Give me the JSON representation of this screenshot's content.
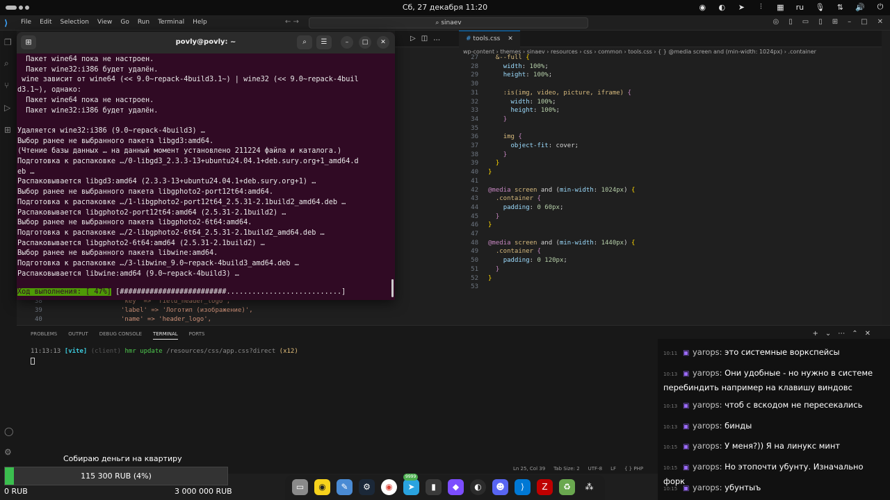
{
  "topbar": {
    "clock": "Сб, 27 декабря 11:20",
    "lang": "ru"
  },
  "vscode": {
    "menu": [
      "File",
      "Edit",
      "Selection",
      "View",
      "Go",
      "Run",
      "Terminal",
      "Help"
    ],
    "search": "sinaev",
    "tab": "tools.css",
    "breadcrumb": "wp-content  ›  themes  ›  sinaev  ›  resources  ›  css  ›  common  ›  tools.css  ›  { } @media screen and (min-width: 1024px)  ›  .container",
    "panel_tabs": [
      "PROBLEMS",
      "OUTPUT",
      "DEBUG CONSOLE",
      "TERMINAL",
      "PORTS"
    ],
    "terminal_line_time": "11:13:13",
    "terminal_line_tag": "[vite]",
    "terminal_line_client": "(client)",
    "terminal_line_hmr": "hmr update",
    "terminal_line_path": "/resources/css/app.css?direct",
    "terminal_line_count": "(x12)",
    "status": [
      "Ln 25, Col 39",
      "Tab Size: 2",
      "UTF-8",
      "LF",
      "{ } PHP"
    ],
    "under_code": [
      {
        "ln": "38",
        "tx": "'key' => 'field_header_logo',"
      },
      {
        "ln": "39",
        "tx": "'label' => 'Логотип (изображение)',"
      },
      {
        "ln": "40",
        "tx": "'name' => 'header_logo',"
      }
    ]
  },
  "terminal": {
    "title": "povly@povly: ~",
    "lines": [
      "  Пакет wine64 пока не настроен.",
      "  Пакет wine32:i386 будет удалён.",
      " wine зависит от wine64 (<< 9.0~repack-4build3.1~) | wine32 (<< 9.0~repack-4buil",
      "d3.1~), однако:",
      "  Пакет wine64 пока не настроен.",
      "  Пакет wine32:i386 будет удалён.",
      "",
      "Удаляется wine32:i386 (9.0~repack-4build3) …",
      "Выбор ранее не выбранного пакета libgd3:amd64.",
      "(Чтение базы данных … на данный момент установлено 211224 файла и каталога.)",
      "Подготовка к распаковке …/0-libgd3_2.3.3-13+ubuntu24.04.1+deb.sury.org+1_amd64.d",
      "eb …",
      "Распаковывается libgd3:amd64 (2.3.3-13+ubuntu24.04.1+deb.sury.org+1) …",
      "Выбор ранее не выбранного пакета libgphoto2-port12t64:amd64.",
      "Подготовка к распаковке …/1-libgphoto2-port12t64_2.5.31-2.1build2_amd64.deb …",
      "Распаковывается libgphoto2-port12t64:amd64 (2.5.31-2.1build2) …",
      "Выбор ранее не выбранного пакета libgphoto2-6t64:amd64.",
      "Подготовка к распаковке …/2-libgphoto2-6t64_2.5.31-2.1build2_amd64.deb …",
      "Распаковывается libgphoto2-6t64:amd64 (2.5.31-2.1build2) …",
      "Выбор ранее не выбранного пакета libwine:amd64.",
      "Подготовка к распаковке …/3-libwine_9.0~repack-4build3_amd64.deb …",
      "Распаковывается libwine:amd64 (9.0~repack-4build3) …"
    ],
    "progress_label": "Ход выполнения: [ 47%]",
    "progress_bar": " [#########################...........................] "
  },
  "code": [
    {
      "ln": "27",
      "html": "  <span class='sel'>&amp;--full</span> <span class='br'>{</span>"
    },
    {
      "ln": "28",
      "html": "    <span class='prop'>width</span>: <span class='num'>100%</span>;"
    },
    {
      "ln": "29",
      "html": "    <span class='prop'>height</span>: <span class='num'>100%</span>;"
    },
    {
      "ln": "30",
      "html": ""
    },
    {
      "ln": "31",
      "html": "    <span class='sel'>:is(img, video, picture, iframe)</span> <span class='kw'>{</span>"
    },
    {
      "ln": "32",
      "html": "      <span class='prop'>width</span>: <span class='num'>100%</span>;"
    },
    {
      "ln": "33",
      "html": "      <span class='prop'>height</span>: <span class='num'>100%</span>;"
    },
    {
      "ln": "34",
      "html": "    <span class='kw'>}</span>"
    },
    {
      "ln": "35",
      "html": ""
    },
    {
      "ln": "36",
      "html": "    <span class='sel'>img</span> <span class='kw'>{</span>"
    },
    {
      "ln": "37",
      "html": "      <span class='prop'>object-fit</span>: cover;"
    },
    {
      "ln": "38",
      "html": "    <span class='kw'>}</span>"
    },
    {
      "ln": "39",
      "html": "  <span class='br'>}</span>"
    },
    {
      "ln": "40",
      "html": "<span class='br'>}</span>"
    },
    {
      "ln": "41",
      "html": ""
    },
    {
      "ln": "42",
      "html": "<span class='kw'>@media</span> <span class='sel'>screen</span> and (<span class='prop'>min-width</span>: <span class='num'>1024px</span>) <span class='br'>{</span>"
    },
    {
      "ln": "43",
      "html": "  <span class='sel'>.container</span> <span class='kw'>{</span>"
    },
    {
      "ln": "44",
      "html": "    <span class='prop'>padding</span>: <span class='num'>0 60px</span>;"
    },
    {
      "ln": "45",
      "html": "  <span class='kw'>}</span>"
    },
    {
      "ln": "46",
      "html": "<span class='br'>}</span>"
    },
    {
      "ln": "47",
      "html": ""
    },
    {
      "ln": "48",
      "html": "<span class='kw'>@media</span> <span class='sel'>screen</span> and (<span class='prop'>min-width</span>: <span class='num'>1440px</span>) <span class='br'>{</span>"
    },
    {
      "ln": "49",
      "html": "  <span class='sel'>.container</span> <span class='kw'>{</span>"
    },
    {
      "ln": "50",
      "html": "    <span class='prop'>padding</span>: <span class='num'>0 120px</span>;"
    },
    {
      "ln": "51",
      "html": "  <span class='kw'>}</span>"
    },
    {
      "ln": "52",
      "html": "<span class='br'>}</span>"
    },
    {
      "ln": "53",
      "html": ""
    }
  ],
  "chat": [
    {
      "time": "10:11",
      "user": "yarops:",
      "text": " это системные воркспейсы"
    },
    {
      "time": "10:13",
      "user": "yarops:",
      "text": " Они удобные - но нужно в системе перебиндить например на клавишу виндовс"
    },
    {
      "time": "10:13",
      "user": "yarops:",
      "text": " чтоб с вскодом не пересекались"
    },
    {
      "time": "10:13",
      "user": "yarops:",
      "text": " бинды"
    },
    {
      "time": "10:15",
      "user": "yarops:",
      "text": " У меня?)) Я на линукс минт"
    },
    {
      "time": "10:15",
      "user": "yarops:",
      "text": " Но этопочти убунту. Изначально форк"
    },
    {
      "time": "10:15",
      "user": "yarops:",
      "text": " убунтыъ"
    }
  ],
  "donation": {
    "title": "Собираю деньги на квартиру",
    "progress_text": "115 300 RUB (4%)",
    "progress_fraction": 0.04,
    "min": "0 RUB",
    "max": "3 000 000 RUB"
  },
  "dock": {
    "badge": "9999",
    "apps": [
      "files-icon",
      "rhythmbox-icon",
      "text-editor-icon",
      "steam-icon",
      "chrome-icon",
      "telegram-icon",
      "terminal-icon",
      "obsidian-icon",
      "obs-icon",
      "discord-icon",
      "vscode-icon",
      "filezilla-icon",
      "trash-icon",
      "apps-grid-icon"
    ]
  }
}
